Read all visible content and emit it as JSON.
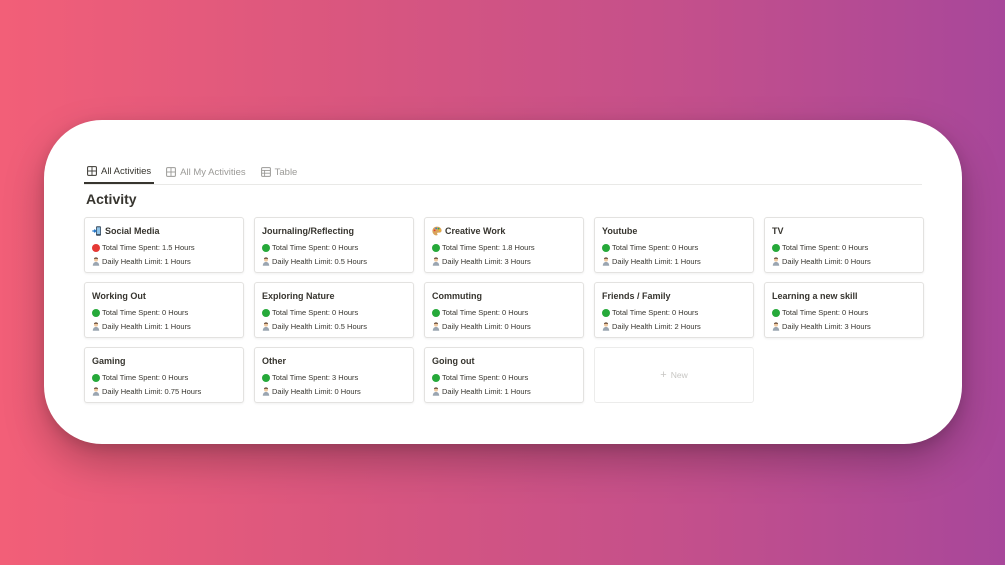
{
  "tabs": [
    {
      "label": "All Activities",
      "icon": "gallery-icon",
      "active": true
    },
    {
      "label": "All My Activities",
      "icon": "gallery-icon",
      "active": false
    },
    {
      "label": "Table",
      "icon": "table-icon",
      "active": false
    }
  ],
  "page_title": "Activity",
  "property_labels": {
    "time": "Total Time Spent:",
    "limit": "Daily Health Limit:"
  },
  "colors": {
    "over_limit": "#e53935",
    "within_limit": "#26a93a",
    "text": "#37352f",
    "muted": "#9b9a97"
  },
  "cards": [
    {
      "title": "Social Media",
      "icon": "mobile-phone-arrow-icon",
      "status": "red",
      "time_value": "1.5 Hours",
      "limit_value": "1 Hours"
    },
    {
      "title": "Journaling/Reflecting",
      "icon": "",
      "status": "green",
      "time_value": "0 Hours",
      "limit_value": "0.5 Hours"
    },
    {
      "title": "Creative Work",
      "icon": "palette-icon",
      "status": "green",
      "time_value": "1.8 Hours",
      "limit_value": "3 Hours"
    },
    {
      "title": "Youtube",
      "icon": "",
      "status": "green",
      "time_value": "0 Hours",
      "limit_value": "1 Hours"
    },
    {
      "title": "TV",
      "icon": "",
      "status": "green",
      "time_value": "0 Hours",
      "limit_value": "0 Hours"
    },
    {
      "title": "Working Out",
      "icon": "",
      "status": "green",
      "time_value": "0 Hours",
      "limit_value": "1 Hours"
    },
    {
      "title": "Exploring Nature",
      "icon": "",
      "status": "green",
      "time_value": "0 Hours",
      "limit_value": "0.5 Hours"
    },
    {
      "title": "Commuting",
      "icon": "",
      "status": "green",
      "time_value": "0 Hours",
      "limit_value": "0 Hours"
    },
    {
      "title": "Friends / Family",
      "icon": "",
      "status": "green",
      "time_value": "0 Hours",
      "limit_value": "2 Hours"
    },
    {
      "title": "Learning a new skill",
      "icon": "",
      "status": "green",
      "time_value": "0 Hours",
      "limit_value": "3 Hours"
    },
    {
      "title": "Gaming",
      "icon": "",
      "status": "green",
      "time_value": "0 Hours",
      "limit_value": "0.75 Hours"
    },
    {
      "title": "Other",
      "icon": "",
      "status": "green",
      "time_value": "3 Hours",
      "limit_value": "0 Hours"
    },
    {
      "title": "Going out",
      "icon": "",
      "status": "green",
      "time_value": "0 Hours",
      "limit_value": "1 Hours"
    }
  ],
  "new_card": {
    "label": "New"
  }
}
